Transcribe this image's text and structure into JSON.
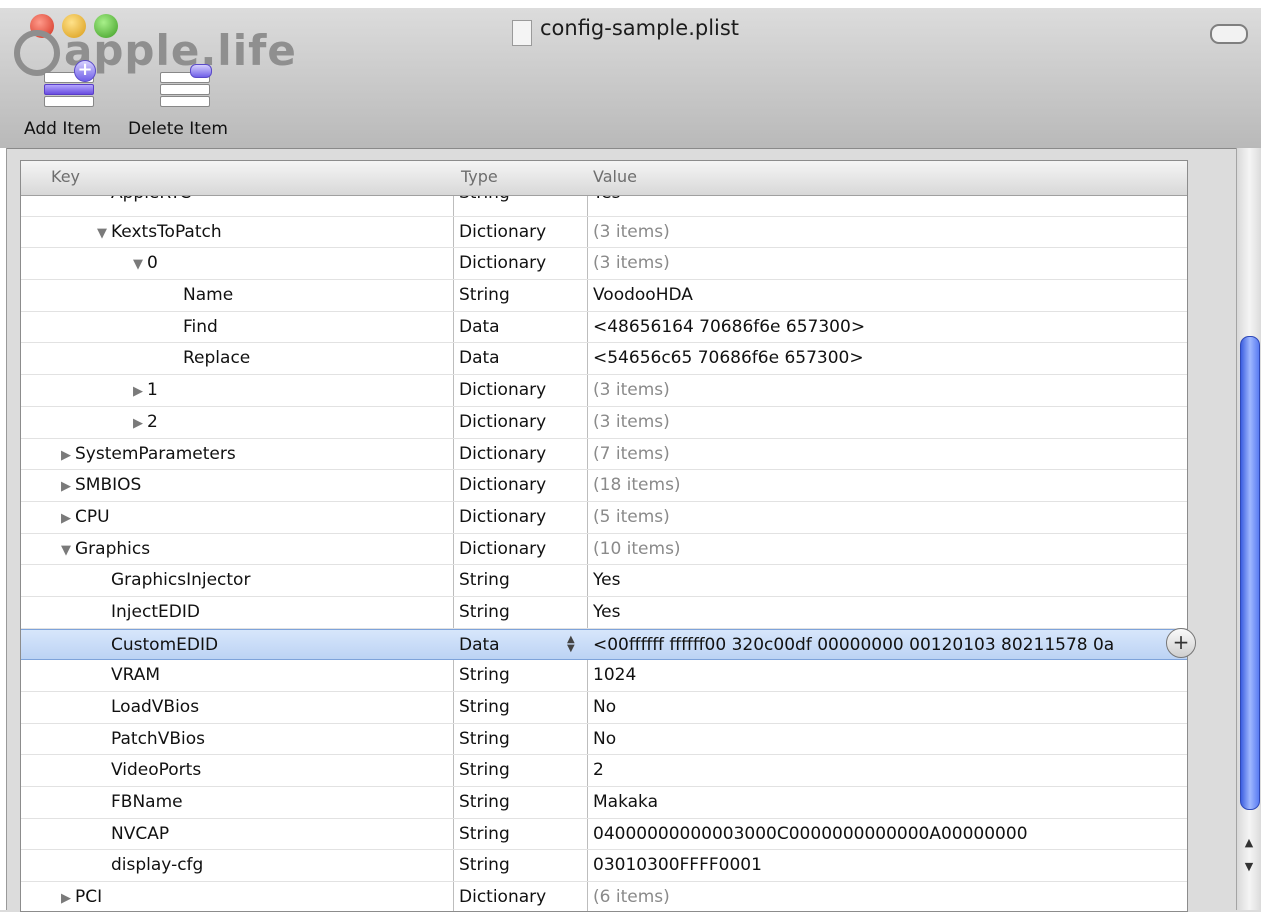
{
  "window": {
    "title": "config-sample.plist",
    "logo_text": "apple.life"
  },
  "toolbar": {
    "add_label": "Add Item",
    "delete_label": "Delete Item"
  },
  "table": {
    "headers": {
      "key": "Key",
      "type": "Type",
      "value": "Value"
    },
    "rows": [
      {
        "indent": 2,
        "disclosure": "",
        "key": "AppleRTC",
        "type": "String",
        "value": "Yes",
        "muted": false
      },
      {
        "indent": 2,
        "disclosure": "▼",
        "key": "KextsToPatch",
        "type": "Dictionary",
        "value": "(3 items)",
        "muted": true
      },
      {
        "indent": 3,
        "disclosure": "▼",
        "key": "0",
        "type": "Dictionary",
        "value": "(3 items)",
        "muted": true
      },
      {
        "indent": 4,
        "disclosure": "",
        "key": "Name",
        "type": "String",
        "value": "VoodooHDA",
        "muted": false
      },
      {
        "indent": 4,
        "disclosure": "",
        "key": "Find",
        "type": "Data",
        "value": "<48656164 70686f6e 657300>",
        "muted": false
      },
      {
        "indent": 4,
        "disclosure": "",
        "key": "Replace",
        "type": "Data",
        "value": "<54656c65 70686f6e 657300>",
        "muted": false
      },
      {
        "indent": 3,
        "disclosure": "▶",
        "key": "1",
        "type": "Dictionary",
        "value": "(3 items)",
        "muted": true
      },
      {
        "indent": 3,
        "disclosure": "▶",
        "key": "2",
        "type": "Dictionary",
        "value": "(3 items)",
        "muted": true
      },
      {
        "indent": 1,
        "disclosure": "▶",
        "key": "SystemParameters",
        "type": "Dictionary",
        "value": "(7 items)",
        "muted": true
      },
      {
        "indent": 1,
        "disclosure": "▶",
        "key": "SMBIOS",
        "type": "Dictionary",
        "value": "(18 items)",
        "muted": true
      },
      {
        "indent": 1,
        "disclosure": "▶",
        "key": "CPU",
        "type": "Dictionary",
        "value": "(5 items)",
        "muted": true
      },
      {
        "indent": 1,
        "disclosure": "▼",
        "key": "Graphics",
        "type": "Dictionary",
        "value": "(10 items)",
        "muted": true
      },
      {
        "indent": 2,
        "disclosure": "",
        "key": "GraphicsInjector",
        "type": "String",
        "value": "Yes",
        "muted": false
      },
      {
        "indent": 2,
        "disclosure": "",
        "key": "InjectEDID",
        "type": "String",
        "value": "Yes",
        "muted": false
      },
      {
        "indent": 2,
        "disclosure": "",
        "key": "CustomEDID",
        "type": "Data",
        "value": "<00ffffff ffffff00 320c00df 00000000 00120103 80211578 0a",
        "muted": false,
        "selected": true
      },
      {
        "indent": 2,
        "disclosure": "",
        "key": "VRAM",
        "type": "String",
        "value": "1024",
        "muted": false
      },
      {
        "indent": 2,
        "disclosure": "",
        "key": "LoadVBios",
        "type": "String",
        "value": "No",
        "muted": false
      },
      {
        "indent": 2,
        "disclosure": "",
        "key": "PatchVBios",
        "type": "String",
        "value": "No",
        "muted": false
      },
      {
        "indent": 2,
        "disclosure": "",
        "key": "VideoPorts",
        "type": "String",
        "value": "2",
        "muted": false
      },
      {
        "indent": 2,
        "disclosure": "",
        "key": "FBName",
        "type": "String",
        "value": "Makaka",
        "muted": false
      },
      {
        "indent": 2,
        "disclosure": "",
        "key": "NVCAP",
        "type": "String",
        "value": "04000000000003000C0000000000000A00000000",
        "muted": false
      },
      {
        "indent": 2,
        "disclosure": "",
        "key": "display-cfg",
        "type": "String",
        "value": "03010300FFFF0001",
        "muted": false
      },
      {
        "indent": 1,
        "disclosure": "▶",
        "key": "PCI",
        "type": "Dictionary",
        "value": "(6 items)",
        "muted": true
      }
    ]
  },
  "icons": {
    "add_row": "+",
    "stepper": "▲▼",
    "scroll_up": "▲",
    "scroll_down": "▼"
  },
  "colors": {
    "selection": "#bcd3f4",
    "scroll_thumb": "#5a7cf2"
  }
}
